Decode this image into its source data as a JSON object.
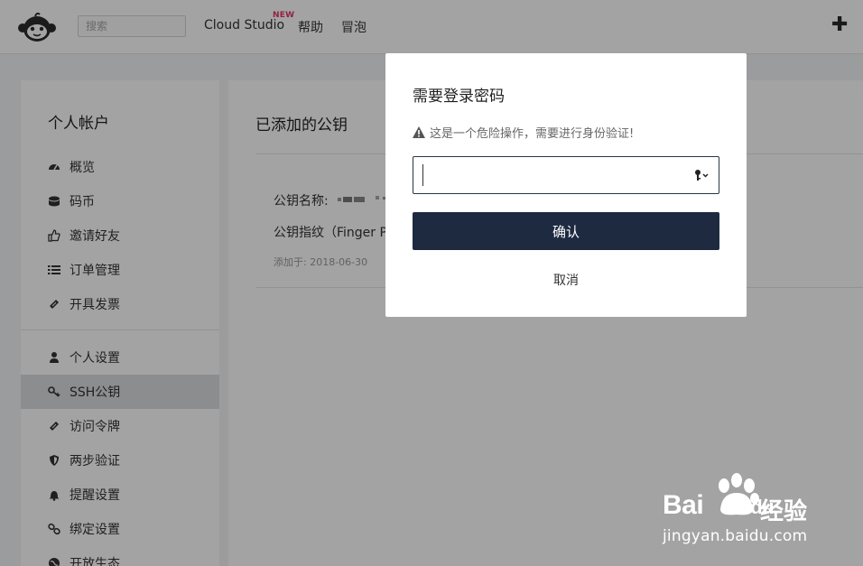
{
  "header": {
    "search_placeholder": "搜索",
    "nav": [
      {
        "label": "Cloud Studio",
        "badge": "NEW"
      },
      {
        "label": "帮助"
      },
      {
        "label": "冒泡"
      }
    ],
    "add_icon": "plus-icon"
  },
  "sidebar": {
    "title": "个人帐户",
    "groups": [
      [
        {
          "label": "概览",
          "icon": "dashboard-icon"
        },
        {
          "label": "码币",
          "icon": "coins-icon"
        },
        {
          "label": "邀请好友",
          "icon": "thumbs-up-icon"
        },
        {
          "label": "订单管理",
          "icon": "list-icon"
        },
        {
          "label": "开具发票",
          "icon": "ticket-icon"
        }
      ],
      [
        {
          "label": "个人设置",
          "icon": "user-icon"
        },
        {
          "label": "SSH公钥",
          "icon": "key-icon",
          "active": true
        },
        {
          "label": "访问令牌",
          "icon": "token-icon"
        },
        {
          "label": "两步验证",
          "icon": "shield-icon"
        },
        {
          "label": "提醒设置",
          "icon": "bell-icon"
        },
        {
          "label": "绑定设置",
          "icon": "link-icon"
        },
        {
          "label": "开放生态",
          "icon": "globe-icon"
        }
      ]
    ]
  },
  "main": {
    "title": "已添加的公钥",
    "key": {
      "name_label": "公钥名称:",
      "fingerprint_label": "公钥指纹（Finger P",
      "added_label": "添加于: 2018-06-30"
    }
  },
  "modal": {
    "title": "需要登录密码",
    "warning": "这是一个危险操作，需要进行身份验证!",
    "password_value": "",
    "confirm_label": "确认",
    "cancel_label": "取消"
  },
  "watermark": {
    "brand": "Bai",
    "brand2": "du",
    "cn": "经验",
    "url": "jingyan.baidu.com"
  },
  "colors": {
    "primary": "#1e2a40",
    "new_badge": "#e8356a",
    "active_item": "#dcdde0"
  }
}
